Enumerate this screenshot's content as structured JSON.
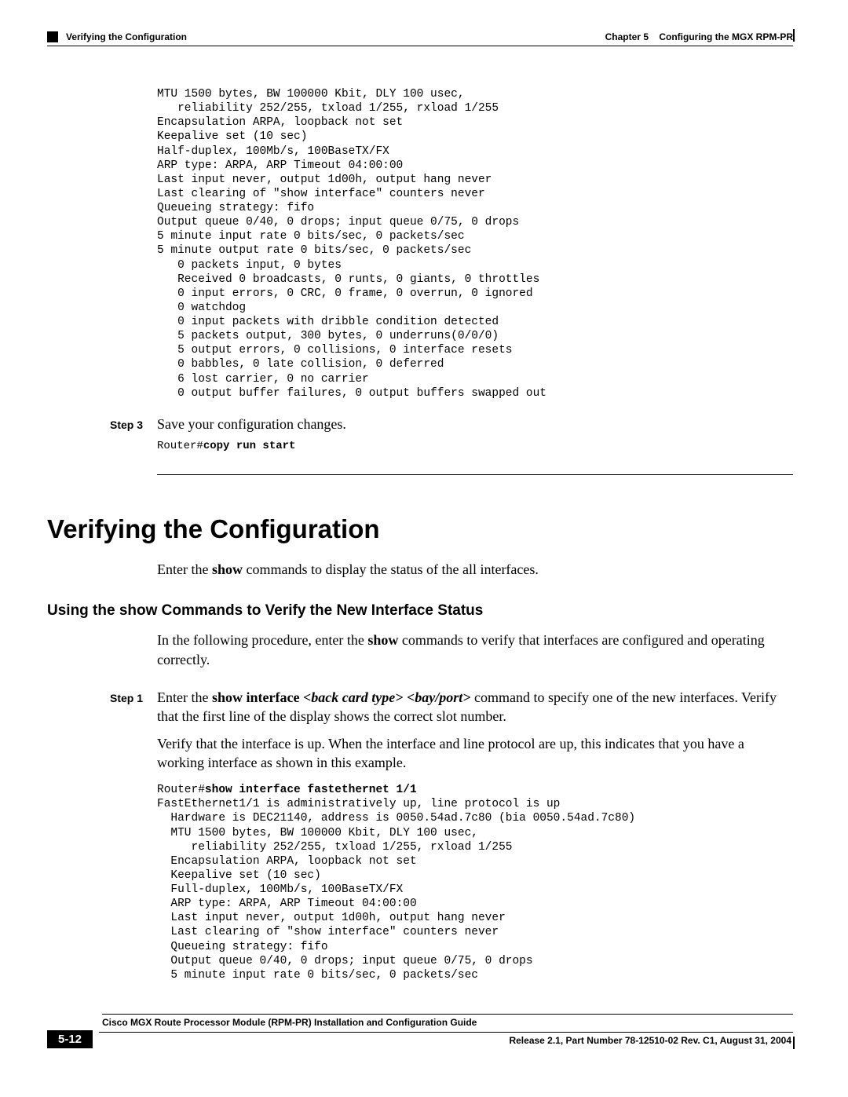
{
  "header": {
    "section": "Verifying the Configuration",
    "chapter_label": "Chapter 5",
    "chapter_title": "Configuring the MGX RPM-PR"
  },
  "code_block_1": "MTU 1500 bytes, BW 100000 Kbit, DLY 100 usec,\n   reliability 252/255, txload 1/255, rxload 1/255\nEncapsulation ARPA, loopback not set\nKeepalive set (10 sec)\nHalf-duplex, 100Mb/s, 100BaseTX/FX\nARP type: ARPA, ARP Timeout 04:00:00\nLast input never, output 1d00h, output hang never\nLast clearing of \"show interface\" counters never\nQueueing strategy: fifo\nOutput queue 0/40, 0 drops; input queue 0/75, 0 drops\n5 minute input rate 0 bits/sec, 0 packets/sec\n5 minute output rate 0 bits/sec, 0 packets/sec\n   0 packets input, 0 bytes\n   Received 0 broadcasts, 0 runts, 0 giants, 0 throttles\n   0 input errors, 0 CRC, 0 frame, 0 overrun, 0 ignored\n   0 watchdog\n   0 input packets with dribble condition detected\n   5 packets output, 300 bytes, 0 underruns(0/0/0)\n   5 output errors, 0 collisions, 0 interface resets\n   0 babbles, 0 late collision, 0 deferred\n   6 lost carrier, 0 no carrier\n   0 output buffer failures, 0 output buffers swapped out",
  "step3": {
    "label": "Step 3",
    "text": "Save your configuration changes.",
    "cmd_prefix": "Router#",
    "cmd_bold": "copy run start"
  },
  "h1": "Verifying the Configuration",
  "intro": {
    "pre": "Enter the ",
    "bold": "show",
    "post": " commands to display the status of the all interfaces."
  },
  "h2": "Using the show Commands to Verify the New Interface Status",
  "para2": {
    "pre": "In the following procedure, enter the ",
    "bold": "show",
    "post": " commands to verify that interfaces are configured and operating correctly."
  },
  "step1": {
    "label": "Step 1",
    "p1_pre": "Enter the ",
    "p1_bold": "show interface",
    "p1_space": " ",
    "p1_i1": "<back card type>",
    "p1_space2": " ",
    "p1_i2": "<bay/port>",
    "p1_post": " command to specify one of the new interfaces. Verify that the first line of the display shows the correct slot number.",
    "p2": "Verify that the interface is up. When the interface and line protocol are up, this indicates that you have a working interface as shown in this example.",
    "cmd_prefix": "Router#",
    "cmd_bold": "show interface fastethernet 1/1",
    "code": "FastEthernet1/1 is administratively up, line protocol is up\n  Hardware is DEC21140, address is 0050.54ad.7c80 (bia 0050.54ad.7c80)\n  MTU 1500 bytes, BW 100000 Kbit, DLY 100 usec,\n     reliability 252/255, txload 1/255, rxload 1/255\n  Encapsulation ARPA, loopback not set\n  Keepalive set (10 sec)\n  Full-duplex, 100Mb/s, 100BaseTX/FX\n  ARP type: ARPA, ARP Timeout 04:00:00\n  Last input never, output 1d00h, output hang never\n  Last clearing of \"show interface\" counters never\n  Queueing strategy: fifo\n  Output queue 0/40, 0 drops; input queue 0/75, 0 drops\n  5 minute input rate 0 bits/sec, 0 packets/sec"
  },
  "footer": {
    "title": "Cisco MGX Route Processor Module (RPM-PR) Installation and Configuration Guide",
    "page": "5-12",
    "release": "Release 2.1, Part Number 78-12510-02 Rev. C1, August 31, 2004"
  }
}
